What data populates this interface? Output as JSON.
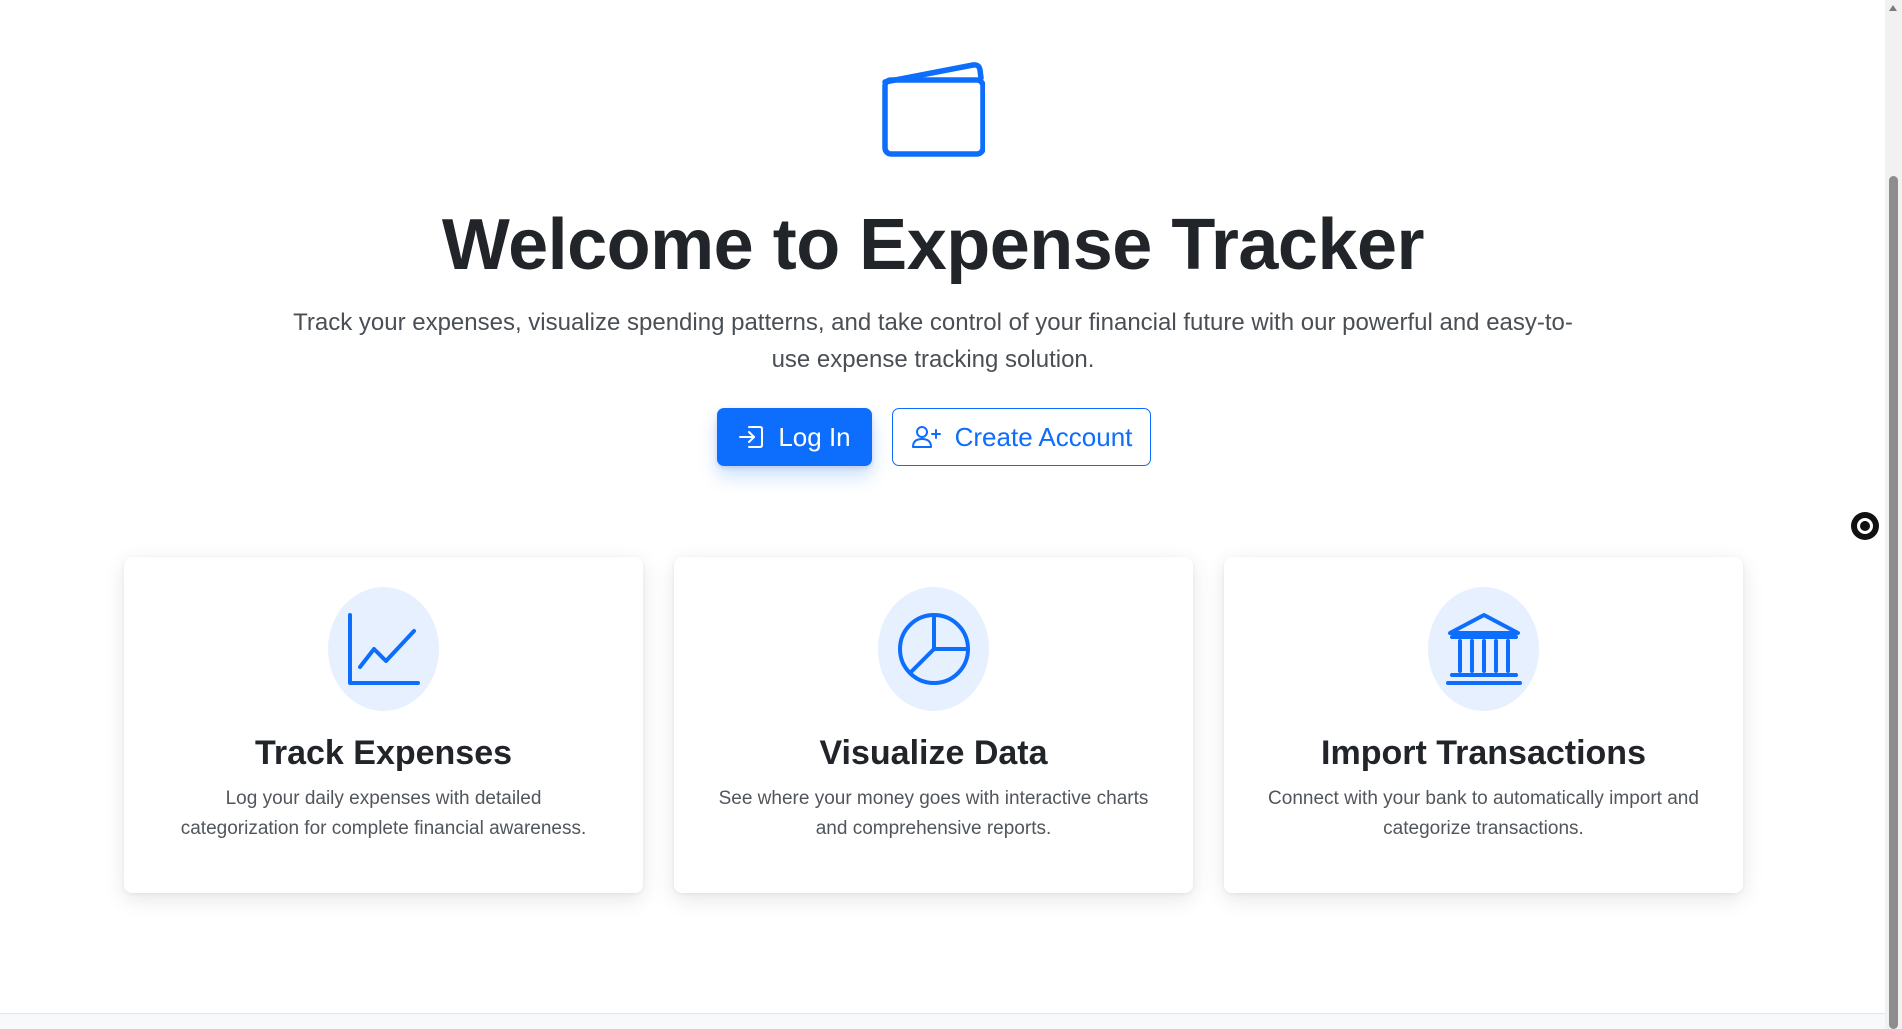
{
  "hero": {
    "icon": "wallet-icon",
    "title": "Welcome to Expense Tracker",
    "subtitle": "Track your expenses, visualize spending patterns, and take control of your financial future with our powerful and easy-to-use expense tracking solution."
  },
  "actions": {
    "login_label": "Log In",
    "login_icon": "login-arrow-icon",
    "create_label": "Create Account",
    "create_icon": "person-plus-icon"
  },
  "features": [
    {
      "icon": "line-chart-icon",
      "title": "Track Expenses",
      "text": "Log your daily expenses with detailed categorization for complete financial awareness."
    },
    {
      "icon": "pie-chart-icon",
      "title": "Visualize Data",
      "text": "See where your money goes with interactive charts and comprehensive reports."
    },
    {
      "icon": "bank-icon",
      "title": "Import Transactions",
      "text": "Connect with your bank to automatically import and categorize transactions."
    }
  ],
  "colors": {
    "primary": "#0d6efd",
    "icon_circle_bg": "#e7f0fe",
    "heading": "#212529",
    "muted_text": "#50565c"
  }
}
